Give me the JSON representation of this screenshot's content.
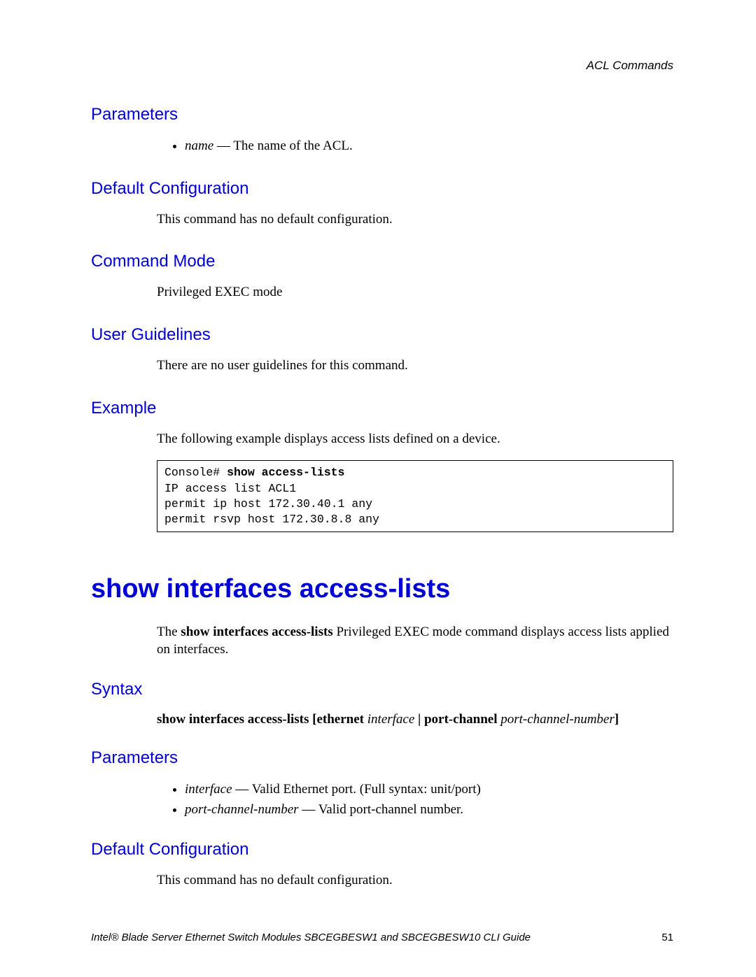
{
  "header": {
    "section": "ACL Commands"
  },
  "sec1": {
    "parameters_h": "Parameters",
    "param1_term": "name",
    "param1_desc": " — The name of the ACL.",
    "defconf_h": "Default Configuration",
    "defconf_body": "This command has no default configuration.",
    "cmdmode_h": "Command Mode",
    "cmdmode_body": "Privileged EXEC mode",
    "guidelines_h": "User Guidelines",
    "guidelines_body": "There are no user guidelines for this command.",
    "example_h": "Example",
    "example_intro": "The following example displays access lists defined on a device.",
    "code_prompt": "Console# ",
    "code_cmd": "show access-lists",
    "code_out1": "IP access list ACL1",
    "code_out2": "permit ip host 172.30.40.1 any",
    "code_out3": "permit rsvp host 172.30.8.8 any"
  },
  "sec2": {
    "title": "show interfaces access-lists",
    "intro_pre": "The ",
    "intro_bold": "show interfaces access-lists",
    "intro_post": " Privileged EXEC mode command displays access lists applied on interfaces.",
    "syntax_h": "Syntax",
    "syntax_b1": "show interfaces access-lists ",
    "syntax_b2": "[ethernet ",
    "syntax_i1": "interface",
    "syntax_b3": " | ",
    "syntax_b4": "port-channel ",
    "syntax_i2": "port-channel-number",
    "syntax_b5": "]",
    "parameters_h": "Parameters",
    "param1_term": "interface",
    "param1_desc": " — Valid Ethernet port. (Full syntax: unit/port)",
    "param2_term": "port-channel-number",
    "param2_desc": " — Valid port-channel number.",
    "defconf_h": "Default Configuration",
    "defconf_body": "This command has no default configuration."
  },
  "footer": {
    "text": "Intel® Blade Server Ethernet Switch Modules SBCEGBESW1 and SBCEGBESW10 CLI Guide",
    "page": "51"
  }
}
